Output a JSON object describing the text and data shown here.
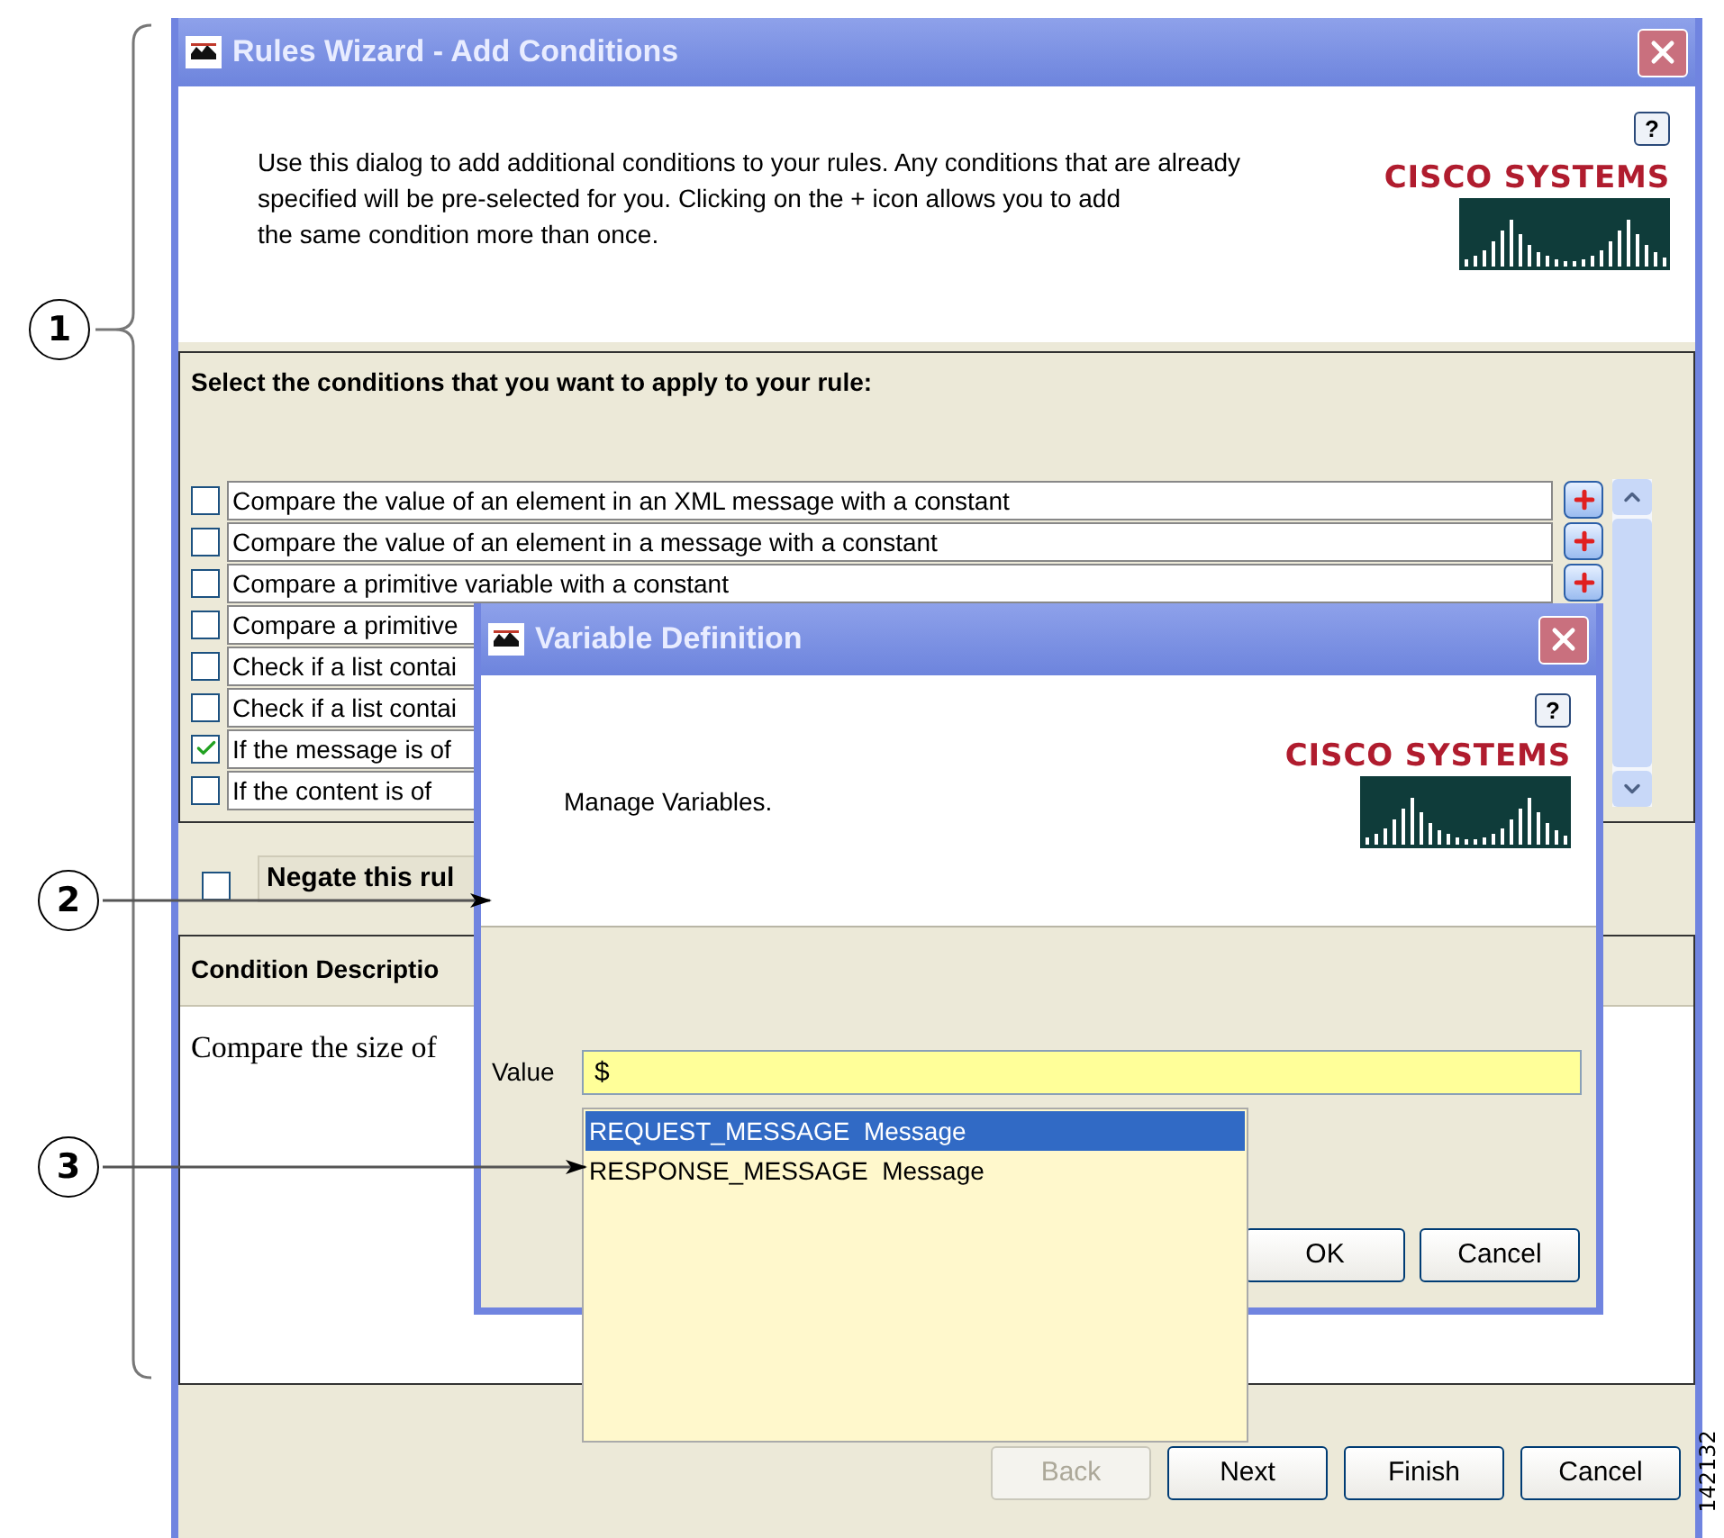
{
  "callouts": [
    {
      "label": "1"
    },
    {
      "label": "2"
    },
    {
      "label": "3"
    }
  ],
  "figure_number": "142132",
  "main_window": {
    "title": "Rules Wizard - Add Conditions",
    "help": "?",
    "intro_lines": [
      "Use this dialog to add additional conditions to your rules. Any conditions that are already",
      "specified will be pre-selected for you. Clicking on the + icon allows you to add",
      "the same condition more than once."
    ],
    "logo": "CISCO SYSTEMS",
    "section_title": "Select the conditions that you want to apply to your rule:",
    "conditions": [
      {
        "text": "Compare the value of an element in an XML message with a constant",
        "checked": false
      },
      {
        "text": "Compare the value of an element in a message with a constant",
        "checked": false
      },
      {
        "text": "Compare a primitive variable with a constant",
        "checked": false
      },
      {
        "text": "Compare a primitive",
        "checked": false
      },
      {
        "text": "Check if a list contai",
        "checked": false
      },
      {
        "text": "Check if a list contai",
        "checked": false
      },
      {
        "text": "If the message is of",
        "checked": true
      },
      {
        "text": "If the content is of",
        "checked": false
      }
    ],
    "negate": {
      "label": "Negate this rul",
      "checked": false
    },
    "description": {
      "title": "Condition Descriptio",
      "text": "Compare the size of"
    },
    "buttons": [
      {
        "label": "Back",
        "disabled": true
      },
      {
        "label": "Next",
        "disabled": false
      },
      {
        "label": "Finish",
        "disabled": false
      },
      {
        "label": "Cancel",
        "disabled": false
      }
    ]
  },
  "variable_dialog": {
    "title": "Variable Definition",
    "help": "?",
    "message": "Manage Variables.",
    "logo": "CISCO SYSTEMS",
    "value_label": "Value",
    "value": "$",
    "suggestions": [
      {
        "text": "REQUEST_MESSAGE  Message",
        "selected": true
      },
      {
        "text": "RESPONSE_MESSAGE  Message",
        "selected": false
      }
    ],
    "buttons": [
      {
        "label": "OK",
        "disabled": false
      },
      {
        "label": "Cancel",
        "disabled": false
      }
    ]
  }
}
